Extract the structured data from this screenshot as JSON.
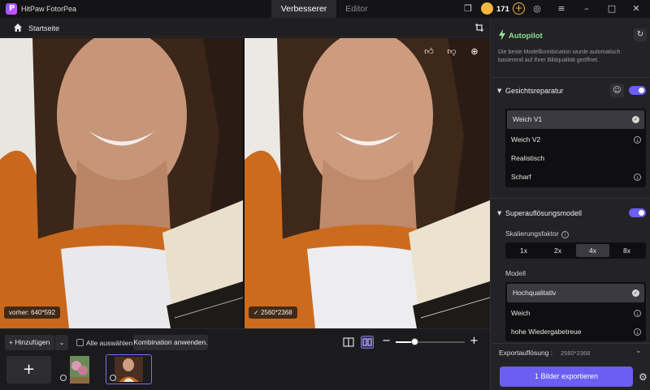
{
  "app": {
    "title": "HitPaw FotorPea"
  },
  "tabs": [
    {
      "label": "Verbesserer",
      "active": true
    },
    {
      "label": "Editor",
      "active": false
    }
  ],
  "credits": {
    "count": "171"
  },
  "subbar": {
    "home_label": "Startseite"
  },
  "viewer": {
    "before_caption": "vorher: 640*592",
    "after_caption": "2560*2368"
  },
  "bottom": {
    "add_label": "Hinzufügen",
    "select_all_label": "Alle auswählen",
    "apply_combo_label": "Kombination anwenden.",
    "zoom_level": 0.28
  },
  "panel": {
    "autopilot": {
      "title": "Autopilot",
      "description": "Die beste Modellkombination wurde automatisch basierend auf Ihrer Bildqualität geöffnet."
    },
    "face_repair": {
      "title": "Gesichtsreparatur",
      "enabled": true,
      "items": [
        {
          "label": "Weich V1",
          "state": "selected"
        },
        {
          "label": "Weich V2",
          "state": "download"
        },
        {
          "label": "Realistisch",
          "state": "none"
        },
        {
          "label": "Scharf",
          "state": "download"
        }
      ]
    },
    "super_res": {
      "title": "Superauflösungsmodell",
      "enabled": true,
      "scale_label": "Skalierungsfaktor",
      "scales": [
        "1x",
        "2x",
        "4x",
        "8x"
      ],
      "selected_scale": "4x",
      "model_label": "Modell",
      "models": [
        {
          "label": "Hochqualitativ",
          "state": "selected"
        },
        {
          "label": "Weich",
          "state": "download"
        },
        {
          "label": "hohe Wiedergabetreue",
          "state": "download"
        }
      ]
    },
    "export": {
      "resolution_label": "Exportauflösung :",
      "resolution_value": "2560*2368",
      "button_label": "1 Bilder exportieren"
    }
  },
  "colors": {
    "accent": "#6b5ef0",
    "autopilot_green": "#8be28b",
    "coin": "#f4b73a"
  }
}
